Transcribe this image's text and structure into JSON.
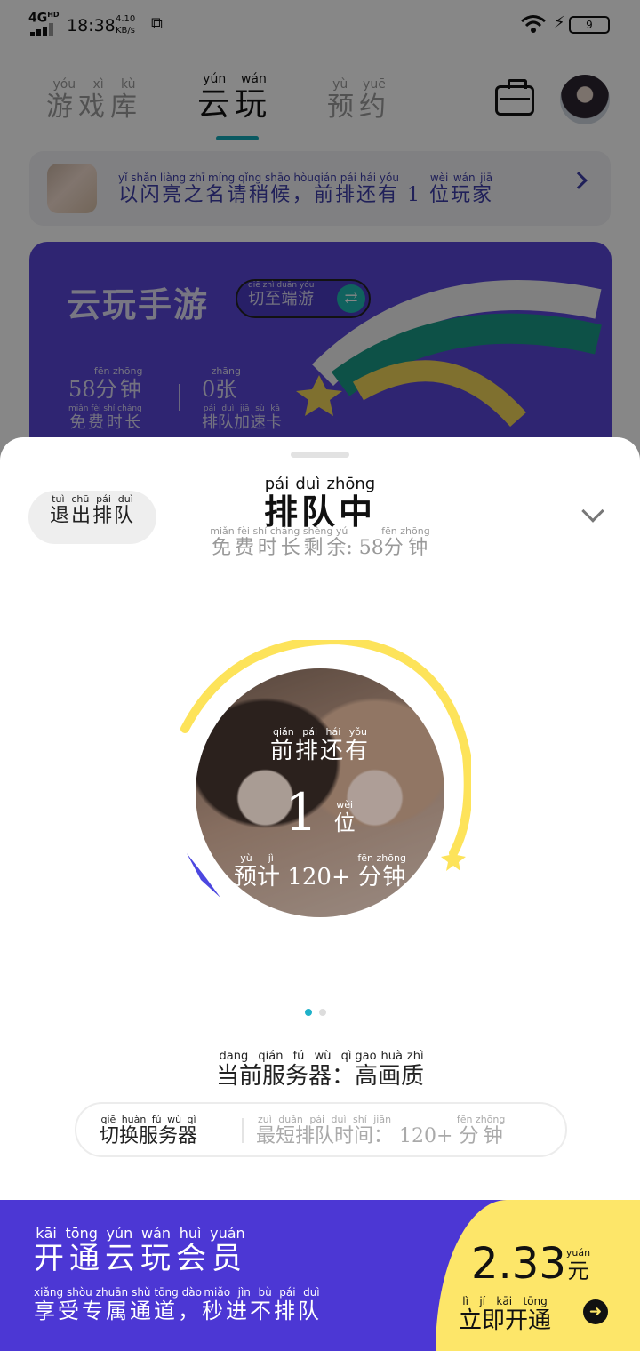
{
  "status_bar": {
    "network": "4G",
    "network_sup": "HD",
    "time": "18:38",
    "speed_value": "4.10",
    "speed_unit": "KB/s",
    "battery": "9"
  },
  "top_nav": {
    "tabs": [
      {
        "label": "游戏库",
        "pinyin": "yóu xì kù"
      },
      {
        "label": "云玩",
        "pinyin": "yún wán"
      },
      {
        "label": "预约",
        "pinyin": "yù yuē"
      }
    ]
  },
  "queue_banner": {
    "text_a": "以闪亮之名请稍候，",
    "pinyin_a": "yǐ shǎn liàng zhī míng qǐng shāo hòu",
    "text_b": "前排还有",
    "pinyin_b": "qián pái hái yǒu",
    "count": "1",
    "text_c": "位玩家",
    "pinyin_c": "wèi wán jiā"
  },
  "promo_card": {
    "title": "云玩手游",
    "switch_label": "切至端游",
    "switch_pinyin": "qiē zhì duān yóu",
    "stat1_value": "58",
    "stat1_unit": "分钟",
    "stat1_unit_pinyin": "fēn zhōng",
    "stat1_label": "免费时长",
    "stat1_label_pinyin": "miǎn fèi shí cháng",
    "stat2_value": "0",
    "stat2_unit": "张",
    "stat2_unit_pinyin": "zhāng",
    "stat2_label": "排队加速卡",
    "stat2_label_pinyin": "pái duì jiā sù kǎ"
  },
  "sheet": {
    "exit_label": "退出排队",
    "exit_pinyin": "tuì chū pái duì",
    "title": "排队中",
    "title_pinyin": "pái duì zhōng",
    "sub_label": "免费时长剩余",
    "sub_pinyin": "miǎn fèi shí cháng shèng yú",
    "sub_value": ": 58",
    "sub_unit": "分钟",
    "sub_unit_pinyin": "fēn zhōng"
  },
  "queue_visual": {
    "ahead": "前排还有",
    "ahead_pinyin": "qián pái hái yǒu",
    "count": "1",
    "count_unit": "位",
    "count_unit_pinyin": "wèi",
    "eta_prefix": "预计",
    "eta_prefix_pinyin": "yù jì",
    "eta_value": "120+",
    "eta_unit": "分钟",
    "eta_unit_pinyin": "fēn zhōng"
  },
  "pager": {
    "active_index": 0,
    "count": 2
  },
  "server": {
    "current_label": "当前服务器：",
    "current_pinyin": "dāng qián fú wù qì",
    "current_value": "高画质",
    "current_value_pinyin": "gāo huà zhì",
    "switch_label": "切换服务器",
    "switch_pinyin": "qiē huàn fú wù qì",
    "shortest_label": "最短排队时间：",
    "shortest_pinyin": "zuì duǎn pái duì shí jiān",
    "shortest_value": "120+",
    "shortest_unit": "分钟",
    "shortest_unit_pinyin": "fēn zhōng"
  },
  "membership": {
    "title": "开通云玩会员",
    "title_pinyin": "kāi tōng yún wán huì yuán",
    "subtitle_a": "享受专属通道，",
    "subtitle_a_pinyin": "xiǎng shòu zhuān shǔ tōng dào",
    "subtitle_b": "秒进不排队",
    "subtitle_b_pinyin": "miǎo jìn bù pái duì",
    "price": "2.33",
    "currency": "元",
    "currency_pinyin": "yuán",
    "cta": "立即开通",
    "cta_pinyin": "lì jí kāi tōng"
  },
  "colors": {
    "accent_teal": "#14a9b8",
    "brand_purple": "#4c37d4",
    "highlight_yellow": "#fde669",
    "ring_yellow": "#fde35a"
  }
}
